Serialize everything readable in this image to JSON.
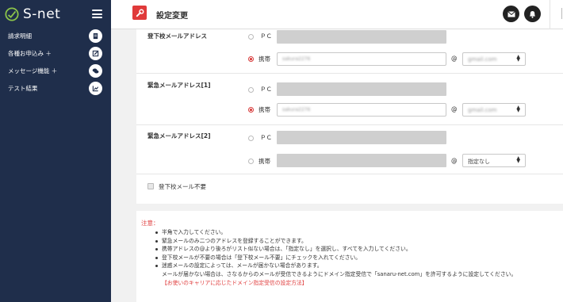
{
  "app": {
    "logo_text": "S-net"
  },
  "sidebar": {
    "items": [
      {
        "label": "請求明細",
        "icon": "document-icon"
      },
      {
        "label": "各種お申込み ＋",
        "icon": "edit-icon"
      },
      {
        "label": "メッセージ機能 ＋",
        "icon": "chat-icon"
      },
      {
        "label": "テスト結果",
        "icon": "chart-icon"
      }
    ]
  },
  "header": {
    "title": "設定変更",
    "accent_color": "#e03a3a"
  },
  "form": {
    "pc_label": "ＰＣ",
    "mobile_label": "携帯",
    "at": "@",
    "sections": [
      {
        "label": "登下校メールアドレス",
        "mobile_user": "sakura2276",
        "mobile_domain": "gmail.com"
      },
      {
        "label": "緊急メールアドレス[1]",
        "mobile_user": "sakura2276",
        "mobile_domain": "gmail.com"
      },
      {
        "label": "緊急メールアドレス[2]",
        "mobile_domain": "指定なし"
      }
    ],
    "checkbox_label": "登下校メール不要"
  },
  "notes": {
    "title": "注意：",
    "items": [
      "半角で入力してください。",
      "緊急メールのみ二つのアドレスを登録することができます。",
      "携帯アドレスの@より後ろがリスト似ない場合は、「指定なし」を選択し、すべてを入力してください。",
      "登下校メールが不要の場合は「登下校メール不要」にチェックを入れてください。",
      "迷惑メールの設定によっては、メールが届かない場合があります。"
    ],
    "sub": "メールが届かない場合は、さなるからのメールが受信できるようにドメイン指定受信で「sanaru-net.com」を許可するように設定してください。",
    "link": "【お使いのキャリアに応じたドメイン指定受信の設定方法】"
  }
}
